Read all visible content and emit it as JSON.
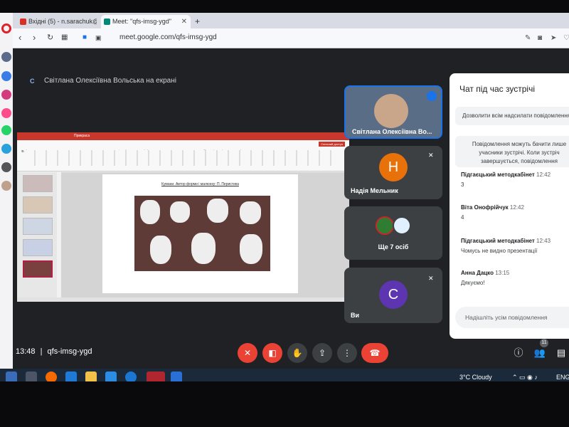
{
  "browser": {
    "tabs": [
      {
        "label": "Вхідні (5) - n.sarachuk@g",
        "active": false
      },
      {
        "label": "Meet: \"qfs-imsg-ygd\"",
        "active": true
      }
    ],
    "new_tab_label": "+",
    "url": "meet.google.com/qfs-imsg-ygd"
  },
  "meet": {
    "presenting_label": "Світлана Олексіївна Вольська на екрані",
    "meeting_code": "qfs-imsg-ygd",
    "time": "13:48",
    "separator": "|",
    "participants_count": "11",
    "colors": {
      "end_call": "#ea4335",
      "muted_btn": "#ea4335",
      "accent": "#8ab4f8",
      "avatar_n": "#e8710a",
      "avatar_c": "#5e35b1"
    }
  },
  "slide": {
    "window_title": "Прикраса",
    "caption": "Кумани. Автор форми і малюнку: П. Перистика",
    "ribbon_tabs": "Файл  Основне  Вставлення  Малювання  Конструктор  Переходи  Анімація  Показ слайдів  Записати  Рецензування  Подання  Office Tab  Довідка  PDF XChange",
    "share_btn": "Спільний доступ"
  },
  "tiles": [
    {
      "name": "Світлана Олексіївна Во...",
      "type": "video"
    },
    {
      "name": "Надія Мельник",
      "initial": "Н",
      "type": "avatar"
    },
    {
      "name": "Ще 7 осіб",
      "type": "group"
    },
    {
      "name": "Ви",
      "initial": "С",
      "type": "avatar"
    }
  ],
  "chat": {
    "title": "Чат під час зустрічі",
    "allow_messages": "Дозволити всім надсилати повідомлення",
    "notice": "Повідомлення можуть бачити лише учасники зустрічі. Коли зустріч завершується, повідомлення видаляються.",
    "messages": [
      {
        "sender": "Підгаєцький методкабінет",
        "time": "12:42",
        "text": "3"
      },
      {
        "sender": "Віта Онофрійчук",
        "time": "12:42",
        "text": "4"
      },
      {
        "sender": "Підгаєцький методкабінет",
        "time": "12:43",
        "text": "Чомусь не видно презентації"
      },
      {
        "sender": "Анна Дацко",
        "time": "13:15",
        "text": "Дякуємо!"
      }
    ],
    "input_placeholder": "Надішліть усім повідомлення"
  },
  "taskbar": {
    "weather": "3°C  Cloudy",
    "lang": "ENG"
  }
}
